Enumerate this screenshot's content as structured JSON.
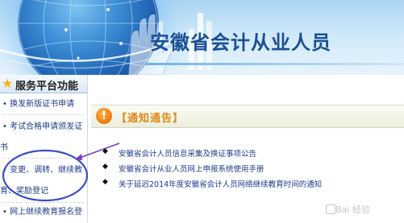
{
  "header": {
    "title": "安徽省会计从业人员"
  },
  "sidebar": {
    "heading": "服务平台功能",
    "items": [
      {
        "line1": "• 换发新版证书申请",
        "line2": ""
      },
      {
        "line1": "• 考试合格申请颁发证",
        "line2": "书"
      },
      {
        "line1": "• 变更、调转、继续教",
        "line2": "育、奖励登记"
      },
      {
        "line1": "• 网上继续教育报名登",
        "line2": ""
      }
    ]
  },
  "notice": {
    "icon_glyph": "!",
    "title": "【通知通告】",
    "items": [
      "安徽省会计人员信息采集及换证事项公告",
      "安徽省会计从业人员网上申报系统使用手册",
      "关于延迟2014年度安徽省会计人员网络继续教育时间的通知"
    ]
  },
  "annotation": {
    "ellipse_color": "#3a4fc6",
    "arrow_color": "#7a3fb8"
  },
  "watermark": "Bai 经验"
}
